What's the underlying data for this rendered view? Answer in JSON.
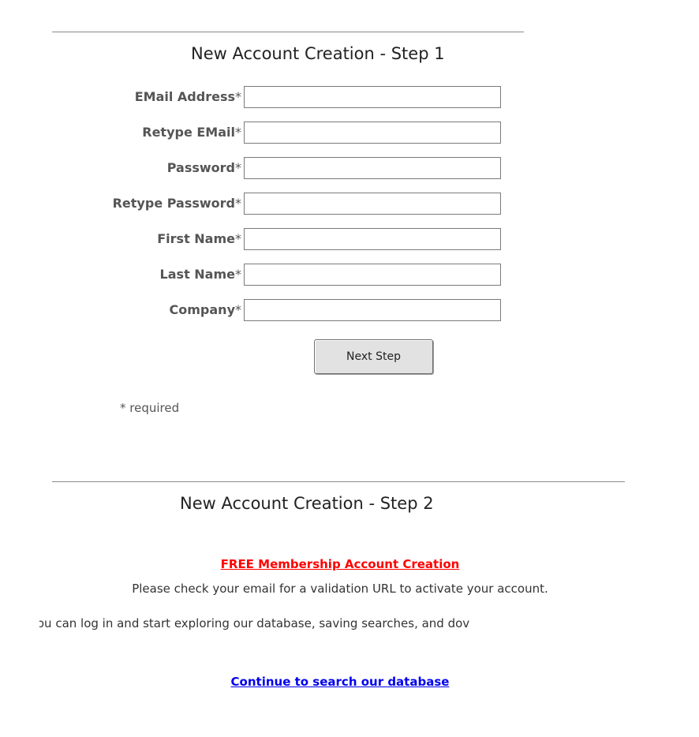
{
  "step1": {
    "heading": "New Account Creation - Step 1",
    "fields": [
      {
        "label": "EMail Address",
        "value": ""
      },
      {
        "label": "Retype EMail",
        "value": ""
      },
      {
        "label": "Password",
        "value": ""
      },
      {
        "label": "Retype Password",
        "value": ""
      },
      {
        "label": "First Name",
        "value": ""
      },
      {
        "label": "Last Name",
        "value": ""
      },
      {
        "label": "Company",
        "value": ""
      }
    ],
    "required_marker": "*",
    "next_button_label": "Next Step",
    "required_note": "* required"
  },
  "step2": {
    "heading": "New Account Creation - Step 2",
    "free_link_text": "FREE Membership Account Creation",
    "check_email_text": "Please check your email for a validation URL to activate your account.",
    "explore_text": "you can log in and start exploring our database, saving searches, and dov",
    "continue_link_text": "Continue to search our database"
  },
  "colors": {
    "free_link": "#ff0000",
    "continue_link": "#0000ee",
    "button_bg": "#e2e2e2",
    "rule": "#8a8a8a"
  }
}
